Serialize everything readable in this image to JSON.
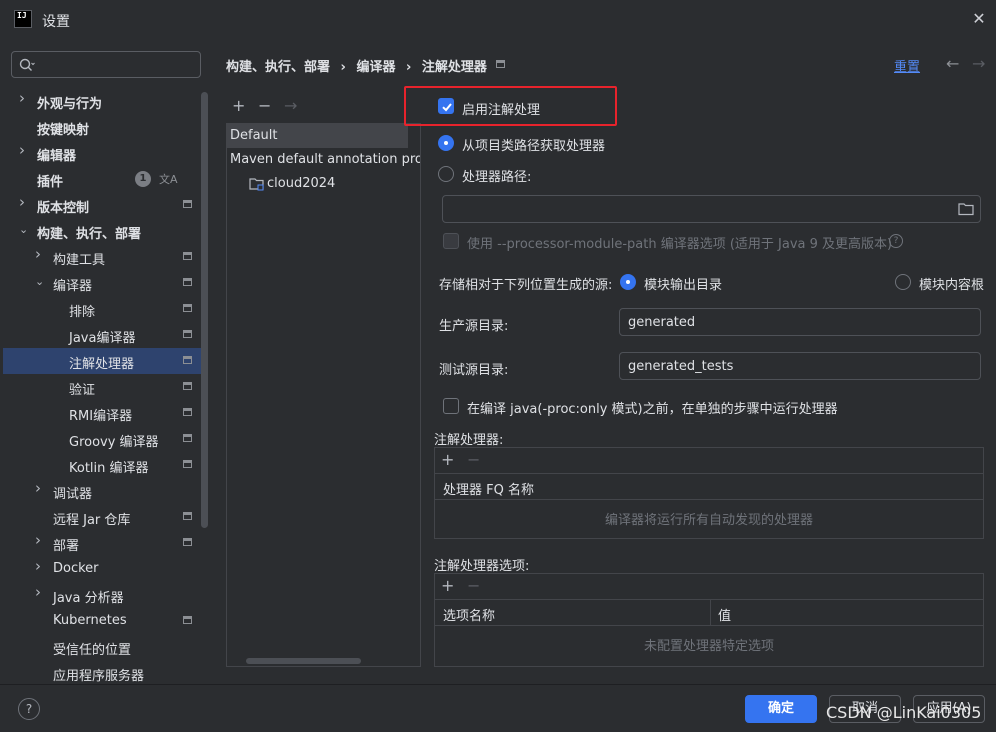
{
  "window": {
    "icon_text": "IJ",
    "title": "设置",
    "close": "✕"
  },
  "search": {
    "placeholder": ""
  },
  "sidebar": {
    "items": [
      {
        "label": "外观与行为",
        "expandable": true,
        "expanded": false,
        "bold": true,
        "level": 0
      },
      {
        "label": "按键映射",
        "expandable": false,
        "bold": true,
        "level": 0
      },
      {
        "label": "编辑器",
        "expandable": true,
        "expanded": false,
        "bold": true,
        "level": 0
      },
      {
        "label": "插件",
        "expandable": false,
        "bold": true,
        "level": 0,
        "badge": "1"
      },
      {
        "label": "版本控制",
        "expandable": true,
        "expanded": false,
        "bold": true,
        "level": 0,
        "modified": true
      },
      {
        "label": "构建、执行、部署",
        "expandable": true,
        "expanded": true,
        "bold": true,
        "level": 0
      },
      {
        "label": "构建工具",
        "expandable": true,
        "expanded": false,
        "level": 1,
        "modified": true
      },
      {
        "label": "编译器",
        "expandable": true,
        "expanded": true,
        "level": 1,
        "modified": true
      },
      {
        "label": "排除",
        "level": 2,
        "modified": true
      },
      {
        "label": "Java编译器",
        "level": 2,
        "modified": true
      },
      {
        "label": "注解处理器",
        "level": 2,
        "modified": true,
        "selected": true
      },
      {
        "label": "验证",
        "level": 2,
        "modified": true
      },
      {
        "label": "RMI编译器",
        "level": 2,
        "modified": true
      },
      {
        "label": "Groovy 编译器",
        "level": 2,
        "modified": true
      },
      {
        "label": "Kotlin 编译器",
        "level": 2,
        "modified": true
      },
      {
        "label": "调试器",
        "expandable": true,
        "expanded": false,
        "level": 1
      },
      {
        "label": "远程 Jar 仓库",
        "level": 1,
        "modified": true
      },
      {
        "label": "部署",
        "expandable": true,
        "expanded": false,
        "level": 1,
        "modified": true
      },
      {
        "label": "Docker",
        "expandable": true,
        "expanded": false,
        "level": 1
      },
      {
        "label": "Java 分析器",
        "expandable": true,
        "expanded": false,
        "level": 1
      },
      {
        "label": "Kubernetes",
        "level": 1,
        "modified": true
      },
      {
        "label": "受信任的位置",
        "level": 1
      },
      {
        "label": "应用程序服务器",
        "level": 1
      }
    ]
  },
  "breadcrumb": {
    "items": [
      "构建、执行、部署",
      "编译器",
      "注解处理器"
    ],
    "separator": "›"
  },
  "header": {
    "reset_label": "重置",
    "back": "←",
    "forward": "→"
  },
  "profiles": {
    "toolbar": {
      "add": "+",
      "remove": "−",
      "move": "→"
    },
    "items": [
      {
        "label": "Default",
        "selected": true
      },
      {
        "label": "Maven default annotation proc"
      },
      {
        "label": "cloud2024"
      }
    ]
  },
  "form": {
    "enable_annotation_processing": {
      "label": "启用注解处理",
      "checked": true
    },
    "obtain_from_classpath": {
      "label": "从项目类路径获取处理器",
      "selected": true
    },
    "processor_path": {
      "label": "处理器路径:",
      "selected": false,
      "value": ""
    },
    "module_path_option": {
      "label": "使用 --processor-module-path 编译器选项 (适用于 Java 9 及更高版本)",
      "checked": false,
      "help": "?"
    },
    "store_generated_sources": {
      "label": "存储相对于下列位置生成的源:",
      "option_output": "模块输出目录",
      "option_content_root": "模块内容根",
      "selected": "模块输出目录"
    },
    "production_sources_dir": {
      "label": "生产源目录:",
      "value": "generated"
    },
    "test_sources_dir": {
      "label": "测试源目录:",
      "value": "generated_tests"
    },
    "run_before_compile": {
      "label": "在编译 java(-proc:only 模式)之前，在单独的步骤中运行处理器",
      "checked": false
    }
  },
  "processors_table": {
    "title": "注解处理器:",
    "toolbar": {
      "add": "+",
      "remove": "−"
    },
    "column": "处理器 FQ 名称",
    "empty_text": "编译器将运行所有自动发现的处理器"
  },
  "options_table": {
    "title": "注解处理器选项:",
    "toolbar": {
      "add": "+",
      "remove": "−"
    },
    "columns": [
      "选项名称",
      "值"
    ],
    "empty_text": "未配置处理器特定选项"
  },
  "footer": {
    "help": "?",
    "ok_label": "确定",
    "cancel_label": "取消",
    "apply_label": "应用(A)"
  },
  "watermark": "CSDN @LinKai0305",
  "colors": {
    "accent": "#3574f0",
    "background": "#2b2d30",
    "selection": "#2e436e",
    "highlight_box": "#e8232c",
    "link": "#548af7"
  }
}
